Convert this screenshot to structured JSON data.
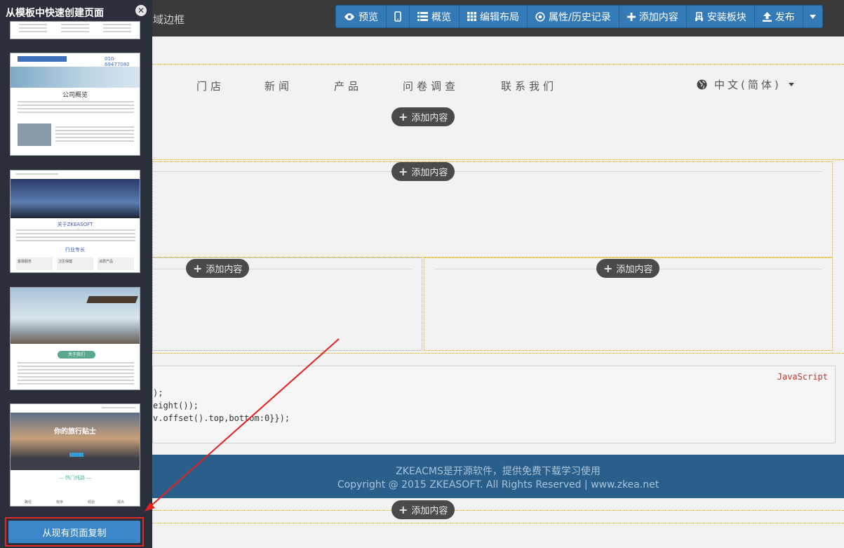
{
  "topbar": {
    "region_label": "域边框",
    "buttons": [
      {
        "icon": "eye-icon",
        "label": "预览"
      },
      {
        "icon": "mobile-icon",
        "label": ""
      },
      {
        "icon": "list-icon",
        "label": "概览"
      },
      {
        "icon": "grid-icon",
        "label": "编辑布局"
      },
      {
        "icon": "target-icon",
        "label": "属性/历史记录"
      },
      {
        "icon": "plus-icon",
        "label": "添加内容"
      },
      {
        "icon": "install-icon",
        "label": "安装板块"
      },
      {
        "icon": "upload-icon",
        "label": "发布"
      },
      {
        "icon": "caret-down-icon",
        "label": ""
      }
    ]
  },
  "nav": {
    "items": [
      "门店",
      "新闻",
      "产品",
      "问卷调查",
      "联系我们"
    ],
    "language": "中文(简体)"
  },
  "add_content_label": "添加内容",
  "code": {
    "tag": "JavaScript",
    "lines": [
      ");",
      "eight());",
      "v.offset().top,bottom:0}});"
    ]
  },
  "footer": {
    "line1": "ZKEACMS是开源软件，提供免费下载学习使用",
    "line2": "Copyright @ 2015 ZKEASOFT. All Rights Reserved | www.zkea.net"
  },
  "panel": {
    "title": "从模板中快速创建页面",
    "copy_button": "从现有页面复制",
    "thumbs": {
      "t2_heading": "公司概览",
      "t2_phone": "010-69477080",
      "t3_heading": "关于ZKEASOFT",
      "t3_sub": "行业专长",
      "t3_cards": [
        "金融服务",
        "卫生保健",
        "消费产品"
      ],
      "t4_pill": "关于我们",
      "t5_heading": "你的旅行贴士",
      "t5_sub": "— 热门线路 —",
      "t5_icons": [
        "路径",
        "有序",
        "经验",
        "观点"
      ]
    }
  },
  "colors": {
    "toolbar_blue": "#337ab7",
    "footer_blue": "#2a5f8b",
    "panel_bg": "#2b2f3c",
    "highlight_red": "#e02b2b"
  }
}
